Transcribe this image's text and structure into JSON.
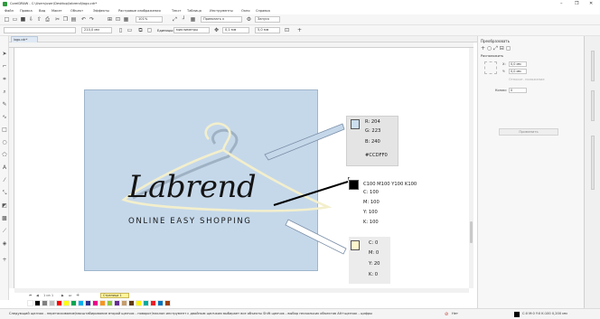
{
  "window": {
    "title": "CorelDRAW - C:\\Users\\user\\Desktop\\labrend\\logo.cdr*",
    "minimize": "–",
    "restore": "❐",
    "close": "✕"
  },
  "menu": [
    "Файл",
    "Правка",
    "Вид",
    "Макет",
    "Объект",
    "Эффекты",
    "Растровые изображения",
    "Текст",
    "Таблица",
    "Инструменты",
    "Окно",
    "Справка"
  ],
  "toolbar": {
    "zoom": "101%",
    "snap": "Привязать к",
    "launch": "Запуск"
  },
  "property_bar": {
    "width": "210,0 мм",
    "height": "297,0 мм",
    "units_label": "Единицы:",
    "units_value": "миллиметры",
    "nudge": "0,1 мм",
    "dup_x": "5,0 мм",
    "dup_y": "5,0 мм"
  },
  "document_tab": "logo.cdr*",
  "artwork": {
    "brand": "Labrend",
    "slogan": "ONLINE EASY SHOPPING"
  },
  "annotations": {
    "rgb": {
      "color": "#CCDFF0",
      "lines": [
        "R: 204",
        "G: 223",
        "B: 240",
        "#CCDFF0"
      ]
    },
    "cmyk_black": {
      "color": "#000000",
      "header": "C100 M100 Y100 K100",
      "lines": [
        "C: 100",
        "M: 100",
        "Y: 100",
        "K: 100"
      ]
    },
    "cream": {
      "color": "#FFF7CC",
      "lines": [
        "C: 0",
        "M: 0",
        "Y: 20",
        "K: 0"
      ]
    }
  },
  "docker": {
    "title": "Преобразовать",
    "section": "Расположить",
    "x_value": "0,0 мм",
    "y_value": "0,0 мм",
    "relative": "Относит. положение",
    "copies_label": "Копии:",
    "copies_value": "0",
    "apply": "Применить",
    "side_tabs": [
      "Подсказки",
      "Свойства объекта",
      "Преобразовать"
    ]
  },
  "page_nav": {
    "info": "1 из 1",
    "page_tab": "Страница 1"
  },
  "palette": [
    "#ffffff",
    "#000000",
    "#808080",
    "#c0c0c0",
    "#ff0000",
    "#ffff00",
    "#00a651",
    "#00aeef",
    "#2e3192",
    "#ec008c",
    "#f7941d",
    "#8dc63f",
    "#662d91",
    "#c69c6d",
    "#603913",
    "#fff200",
    "#00a99d",
    "#ed1c24",
    "#0072bc",
    "#a0410d"
  ],
  "status": {
    "hint": "Следующий щелчок - перетаскивание/масштабирование второй щелчок - поворот/наклон инструмент с двойным щелчком выбирает все объекты Shift щелчок - выбор нескольких объектов Alt+щелчок - цифры",
    "fill": "C:0 M:0 Y:0 K:100 0,200 мм",
    "stroke": "Нет"
  }
}
